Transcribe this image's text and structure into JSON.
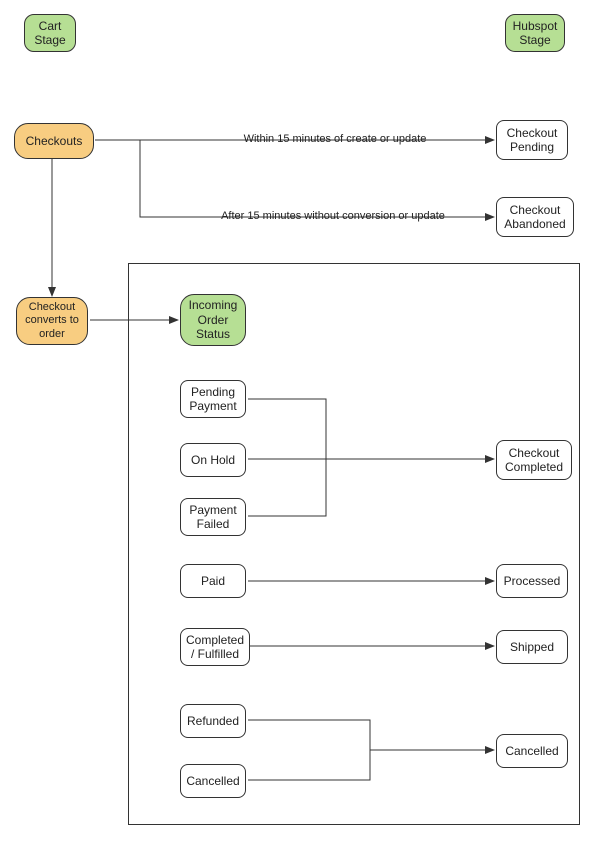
{
  "headers": {
    "cart_stage": "Cart\nStage",
    "hubspot_stage": "Hubspot\nStage"
  },
  "cart": {
    "checkouts": "Checkouts",
    "checkout_converts": "Checkout\nconverts to\norder",
    "incoming_order_status": "Incoming\nOrder\nStatus"
  },
  "edges": {
    "within_15": "Within 15 minutes of create or update",
    "after_15": "After 15 minutes without conversion or update"
  },
  "hubspot": {
    "checkout_pending": "Checkout\nPending",
    "checkout_abandoned": "Checkout\nAbandoned",
    "checkout_completed": "Checkout\nCompleted",
    "processed": "Processed",
    "shipped": "Shipped",
    "cancelled": "Cancelled"
  },
  "order_status": {
    "pending_payment": "Pending\nPayment",
    "on_hold": "On Hold",
    "payment_failed": "Payment\nFailed",
    "paid": "Paid",
    "completed_fulfilled": "Completed\n/ Fulfilled",
    "refunded": "Refunded",
    "cancelled": "Cancelled"
  }
}
